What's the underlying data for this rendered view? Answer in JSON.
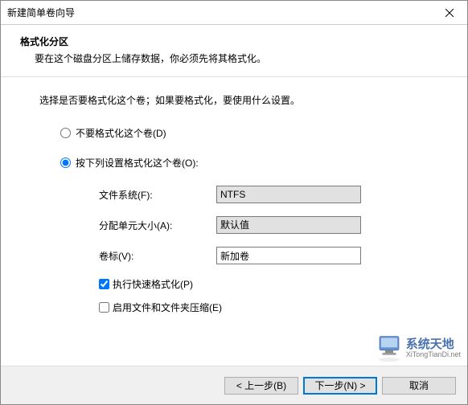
{
  "title": "新建简单卷向导",
  "header": {
    "title": "格式化分区",
    "desc": "要在这个磁盘分区上储存数据，你必须先将其格式化。"
  },
  "instruction": "选择是否要格式化这个卷；如果要格式化，要使用什么设置。",
  "radio": {
    "noFormat": "不要格式化这个卷(D)",
    "formatWith": "按下列设置格式化这个卷(O):"
  },
  "form": {
    "fileSystemLabel": "文件系统(F):",
    "fileSystemValue": "NTFS",
    "allocUnitLabel": "分配单元大小(A):",
    "allocUnitValue": "默认值",
    "volumeLabelLabel": "卷标(V):",
    "volumeLabelValue": "新加卷",
    "quickFormat": "执行快速格式化(P)",
    "enableCompression": "启用文件和文件夹压缩(E)"
  },
  "buttons": {
    "back": "< 上一步(B)",
    "next": "下一步(N) >",
    "cancel": "取消"
  },
  "watermark": {
    "cn": "系统天地",
    "url": "XiTongTianDi.net"
  }
}
